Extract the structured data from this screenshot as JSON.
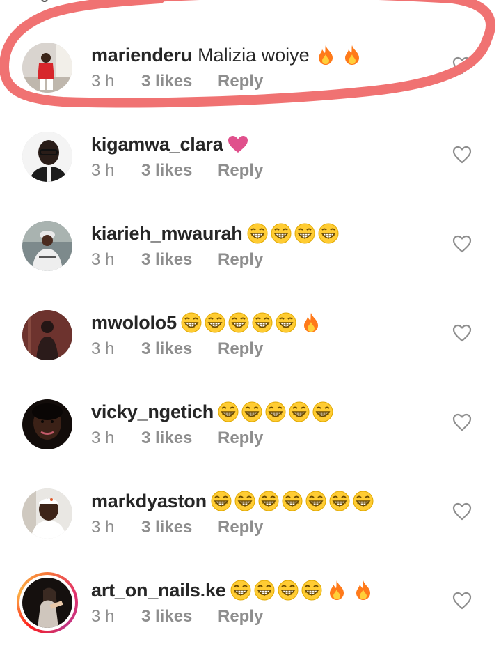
{
  "colors": {
    "text_primary": "#262626",
    "text_secondary": "#8e8e8e",
    "highlight_stroke": "#f07272",
    "heart_emoji": "#e0508c",
    "laugh_emoji": "#ffcc33",
    "fire_emoji": "#ff7a1a"
  },
  "comments": [
    {
      "username": "marienderu",
      "text": "Malizia woiye",
      "emojis": [
        "fire-emoji",
        "fire-emoji"
      ],
      "time": "3 h",
      "likes": "3 likes",
      "reply": "Reply",
      "highlighted": true
    },
    {
      "username": "kigamwa_clara",
      "text": "",
      "emojis": [
        "pink-heart-emoji"
      ],
      "time": "3 h",
      "likes": "3 likes",
      "reply": "Reply"
    },
    {
      "username": "kiarieh_mwaurah",
      "text": "",
      "emojis": [
        "laughing-emoji",
        "laughing-emoji",
        "laughing-emoji",
        "laughing-emoji"
      ],
      "time": "3 h",
      "likes": "3 likes",
      "reply": "Reply"
    },
    {
      "username": "mwololo5",
      "text": "",
      "emojis": [
        "laughing-emoji",
        "laughing-emoji",
        "laughing-emoji",
        "laughing-emoji",
        "laughing-emoji",
        "fire-emoji"
      ],
      "time": "3 h",
      "likes": "3 likes",
      "reply": "Reply"
    },
    {
      "username": "vicky_ngetich",
      "text": "",
      "emojis": [
        "laughing-emoji",
        "laughing-emoji",
        "laughing-emoji",
        "laughing-emoji",
        "laughing-emoji"
      ],
      "time": "3 h",
      "likes": "3 likes",
      "reply": "Reply"
    },
    {
      "username": "markdyaston",
      "text": "",
      "emojis": [
        "laughing-emoji",
        "laughing-emoji",
        "laughing-emoji",
        "laughing-emoji",
        "laughing-emoji",
        "laughing-emoji",
        "laughing-emoji"
      ],
      "time": "3 h",
      "likes": "3 likes",
      "reply": "Reply"
    },
    {
      "username": "art_on_nails.ke",
      "text": "",
      "emojis": [
        "laughing-emoji",
        "laughing-emoji",
        "laughing-emoji",
        "laughing-emoji",
        "fire-emoji",
        "fire-emoji"
      ],
      "time": "3 h",
      "likes": "3 likes",
      "reply": "Reply",
      "story_ring": true
    }
  ]
}
